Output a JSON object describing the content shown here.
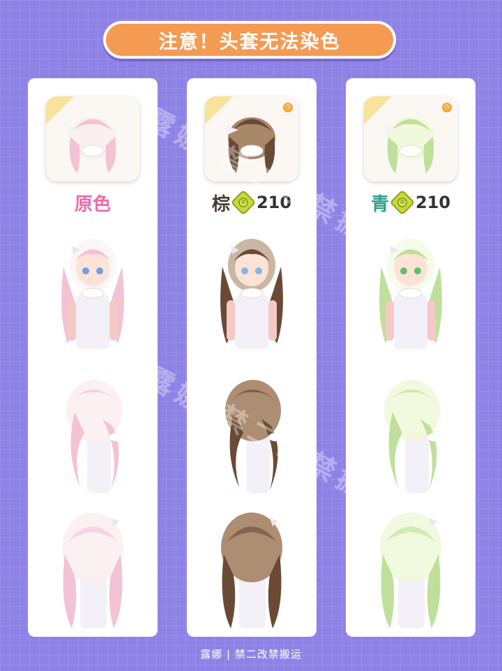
{
  "header": {
    "title": "注意！头套无法染色"
  },
  "variants": [
    {
      "name": "原色",
      "name_color": "#ee6ba8",
      "price": "",
      "hair_color": "#f4c2d5",
      "hair_light": "#fbeef0",
      "eye_color": "#6fa0e0",
      "has_clock": false
    },
    {
      "name": "棕",
      "name_color": "#4a3b35",
      "price": "210",
      "hair_color": "#6b4a35",
      "hair_light": "#a07a5a",
      "eye_color": "#7fb8e8",
      "has_clock": true
    },
    {
      "name": "青",
      "name_color": "#2e9f8c",
      "price": "210",
      "hair_color": "#bfe09a",
      "hair_light": "#eef8d8",
      "eye_color": "#5fbf6a",
      "has_clock": true
    }
  ],
  "watermark": "露娜 禁二改禁搬运",
  "footer": {
    "text": "露娜 | 禁二改禁搬运"
  },
  "colors": {
    "background": "#8f82e6",
    "title_pill": "#f49a52",
    "coin": "#c8d83a"
  }
}
